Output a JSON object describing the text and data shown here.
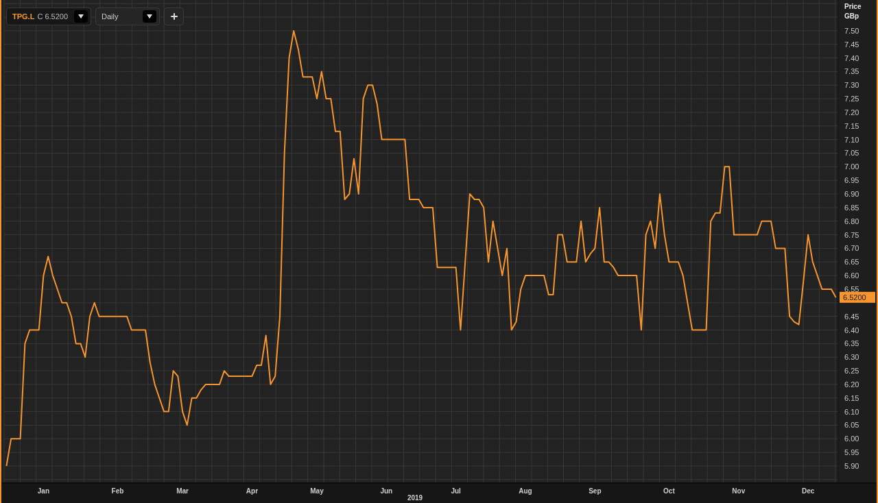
{
  "toolbar": {
    "instrument": {
      "symbol": "TPG.L",
      "quote": "C 6.5200"
    },
    "interval": {
      "value": "Daily"
    }
  },
  "chart": {
    "price_label": "Price",
    "unit_label": "GBp",
    "last_price": "6.5200",
    "chart_data": {
      "type": "line",
      "xlabel": "2019",
      "grid": true,
      "ylim": [
        5.837,
        7.613
      ],
      "categories": [
        null,
        null,
        null,
        null,
        null,
        null,
        null,
        null,
        "Jan",
        null,
        null,
        null,
        null,
        null,
        null,
        null,
        null,
        null,
        null,
        null,
        null,
        null,
        null,
        null,
        "Feb",
        null,
        null,
        null,
        null,
        null,
        null,
        null,
        null,
        null,
        null,
        null,
        null,
        null,
        "Mar",
        null,
        null,
        null,
        null,
        null,
        null,
        null,
        null,
        null,
        null,
        null,
        null,
        null,
        null,
        "Apr",
        null,
        null,
        null,
        null,
        null,
        null,
        null,
        null,
        null,
        null,
        null,
        null,
        null,
        "May",
        null,
        null,
        null,
        null,
        null,
        null,
        null,
        null,
        null,
        null,
        null,
        null,
        null,
        null,
        "Jun",
        null,
        null,
        null,
        null,
        null,
        null,
        null,
        null,
        null,
        null,
        null,
        null,
        null,
        null,
        "Jul",
        null,
        null,
        null,
        null,
        null,
        null,
        null,
        null,
        null,
        null,
        null,
        null,
        null,
        null,
        "Aug",
        null,
        null,
        null,
        null,
        null,
        null,
        null,
        null,
        null,
        null,
        null,
        null,
        null,
        null,
        "Sep",
        null,
        null,
        null,
        null,
        null,
        null,
        null,
        null,
        null,
        null,
        null,
        null,
        null,
        null,
        null,
        "Oct",
        null,
        null,
        null,
        null,
        null,
        null,
        null,
        null,
        null,
        null,
        null,
        null,
        null,
        null,
        "Nov",
        null,
        null,
        null,
        null,
        null,
        null,
        null,
        null,
        null,
        null,
        null,
        null,
        null,
        null,
        "Dec",
        null,
        null,
        null,
        null,
        null,
        null
      ],
      "yticks": [
        {
          "value": 5.9,
          "label": "5.90"
        },
        {
          "value": 5.95,
          "label": "5.95"
        },
        {
          "value": 6.0,
          "label": "6.00"
        },
        {
          "value": 6.05,
          "label": "6.05"
        },
        {
          "value": 6.1,
          "label": "6.10"
        },
        {
          "value": 6.15,
          "label": "6.15"
        },
        {
          "value": 6.2,
          "label": "6.20"
        },
        {
          "value": 6.25,
          "label": "6.25"
        },
        {
          "value": 6.3,
          "label": "6.30"
        },
        {
          "value": 6.35,
          "label": "6.35"
        },
        {
          "value": 6.4,
          "label": "6.40"
        },
        {
          "value": 6.45,
          "label": "6.45"
        },
        {
          "value": 6.55,
          "label": "6.55"
        },
        {
          "value": 6.6,
          "label": "6.60"
        },
        {
          "value": 6.65,
          "label": "6.65"
        },
        {
          "value": 6.7,
          "label": "6.70"
        },
        {
          "value": 6.75,
          "label": "6.75"
        },
        {
          "value": 6.8,
          "label": "6.80"
        },
        {
          "value": 6.85,
          "label": "6.85"
        },
        {
          "value": 6.9,
          "label": "6.90"
        },
        {
          "value": 6.95,
          "label": "6.95"
        },
        {
          "value": 7.0,
          "label": "7.00"
        },
        {
          "value": 7.05,
          "label": "7.05"
        },
        {
          "value": 7.1,
          "label": "7.10"
        },
        {
          "value": 7.15,
          "label": "7.15"
        },
        {
          "value": 7.2,
          "label": "7.20"
        },
        {
          "value": 7.25,
          "label": "7.25"
        },
        {
          "value": 7.3,
          "label": "7.30"
        },
        {
          "value": 7.35,
          "label": "7.35"
        },
        {
          "value": 7.4,
          "label": "7.40"
        },
        {
          "value": 7.45,
          "label": "7.45"
        },
        {
          "value": 7.5,
          "label": "7.50"
        }
      ],
      "series": [
        {
          "color": "#f7952e",
          "values": [
            5.9,
            6.0,
            6.0,
            6.0,
            6.35,
            6.4,
            6.4,
            6.4,
            6.6,
            6.67,
            6.6,
            6.55,
            6.5,
            6.5,
            6.45,
            6.35,
            6.35,
            6.3,
            6.45,
            6.5,
            6.45,
            6.45,
            6.45,
            6.45,
            6.45,
            6.45,
            6.45,
            6.4,
            6.4,
            6.4,
            6.4,
            6.28,
            6.2,
            6.15,
            6.1,
            6.1,
            6.25,
            6.23,
            6.1,
            6.05,
            6.15,
            6.15,
            6.18,
            6.2,
            6.2,
            6.2,
            6.2,
            6.25,
            6.23,
            6.23,
            6.23,
            6.23,
            6.23,
            6.23,
            6.27,
            6.27,
            6.38,
            6.2,
            6.23,
            6.45,
            7.05,
            7.4,
            7.5,
            7.43,
            7.33,
            7.33,
            7.33,
            7.25,
            7.35,
            7.25,
            7.25,
            7.13,
            7.13,
            6.88,
            6.9,
            7.03,
            6.9,
            7.25,
            7.3,
            7.3,
            7.23,
            7.1,
            7.1,
            7.1,
            7.1,
            7.1,
            7.1,
            6.88,
            6.88,
            6.88,
            6.85,
            6.85,
            6.85,
            6.63,
            6.63,
            6.63,
            6.63,
            6.63,
            6.4,
            6.65,
            6.9,
            6.88,
            6.88,
            6.85,
            6.65,
            6.8,
            6.7,
            6.6,
            6.7,
            6.4,
            6.43,
            6.55,
            6.6,
            6.6,
            6.6,
            6.6,
            6.6,
            6.53,
            6.53,
            6.75,
            6.75,
            6.65,
            6.65,
            6.65,
            6.8,
            6.65,
            6.68,
            6.7,
            6.85,
            6.65,
            6.65,
            6.63,
            6.6,
            6.6,
            6.6,
            6.6,
            6.6,
            6.4,
            6.75,
            6.8,
            6.7,
            6.9,
            6.75,
            6.65,
            6.65,
            6.65,
            6.6,
            6.5,
            6.4,
            6.4,
            6.4,
            6.4,
            6.8,
            6.83,
            6.83,
            7.0,
            7.0,
            6.75,
            6.75,
            6.75,
            6.75,
            6.75,
            6.75,
            6.8,
            6.8,
            6.8,
            6.7,
            6.7,
            6.7,
            6.45,
            6.43,
            6.42,
            6.58,
            6.75,
            6.65,
            6.6,
            6.55,
            6.55,
            6.55,
            6.52
          ]
        }
      ]
    }
  }
}
